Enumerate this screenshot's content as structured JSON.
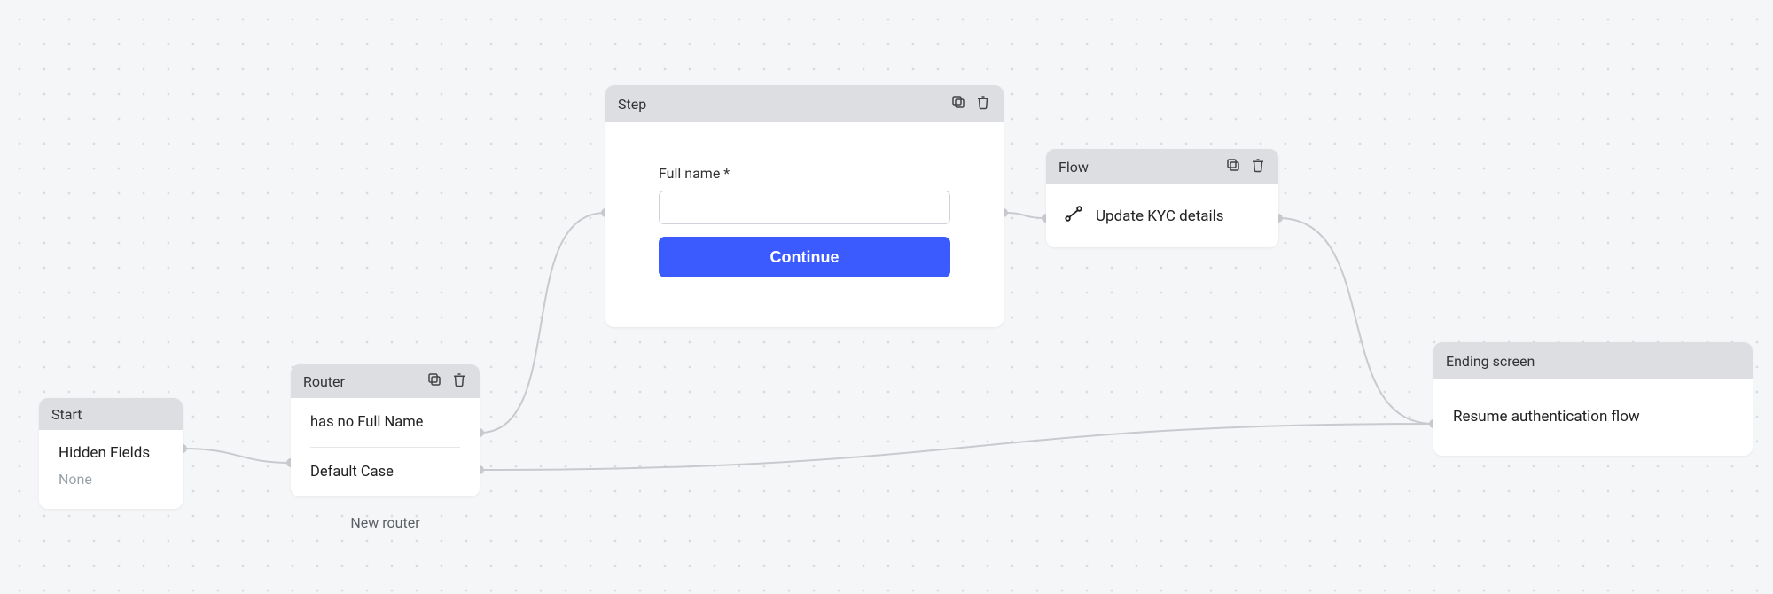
{
  "nodes": {
    "start": {
      "header_title": "Start",
      "hidden_fields_label": "Hidden Fields",
      "hidden_fields_value": "None"
    },
    "router": {
      "header_title": "Router",
      "cases": {
        "case1": "has no Full Name",
        "case2": "Default Case"
      },
      "caption": "New router"
    },
    "step": {
      "header_title": "Step",
      "field_label": "Full name *",
      "cta_label": "Continue"
    },
    "flow": {
      "header_title": "Flow",
      "action_label": "Update KYC details"
    },
    "ending": {
      "header_title": "Ending screen",
      "text": "Resume authentication flow"
    }
  },
  "icons": {
    "duplicate": "duplicate-icon",
    "delete": "trash-icon",
    "path": "path-icon"
  },
  "colors": {
    "edge": "#c8cacf",
    "node_header": "#dcdee2",
    "primary_button": "#3c5bff"
  }
}
